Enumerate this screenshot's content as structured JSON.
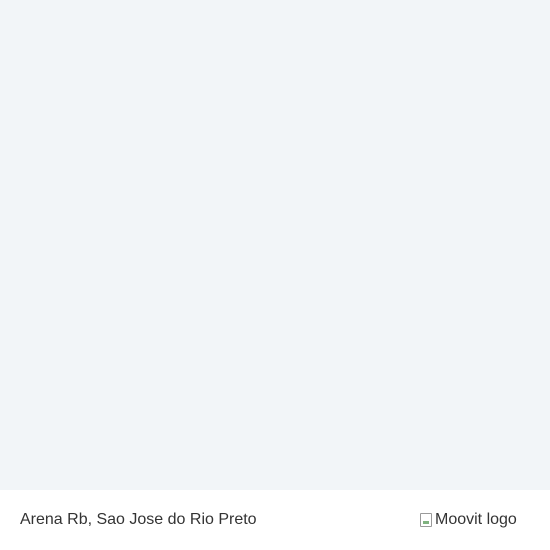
{
  "map": {
    "background_color": "#f2f5f8"
  },
  "footer": {
    "place_name": "Arena Rb, Sao Jose do Rio Preto",
    "logo_alt": "Moovit logo",
    "logo_icon": "broken-image-icon"
  }
}
